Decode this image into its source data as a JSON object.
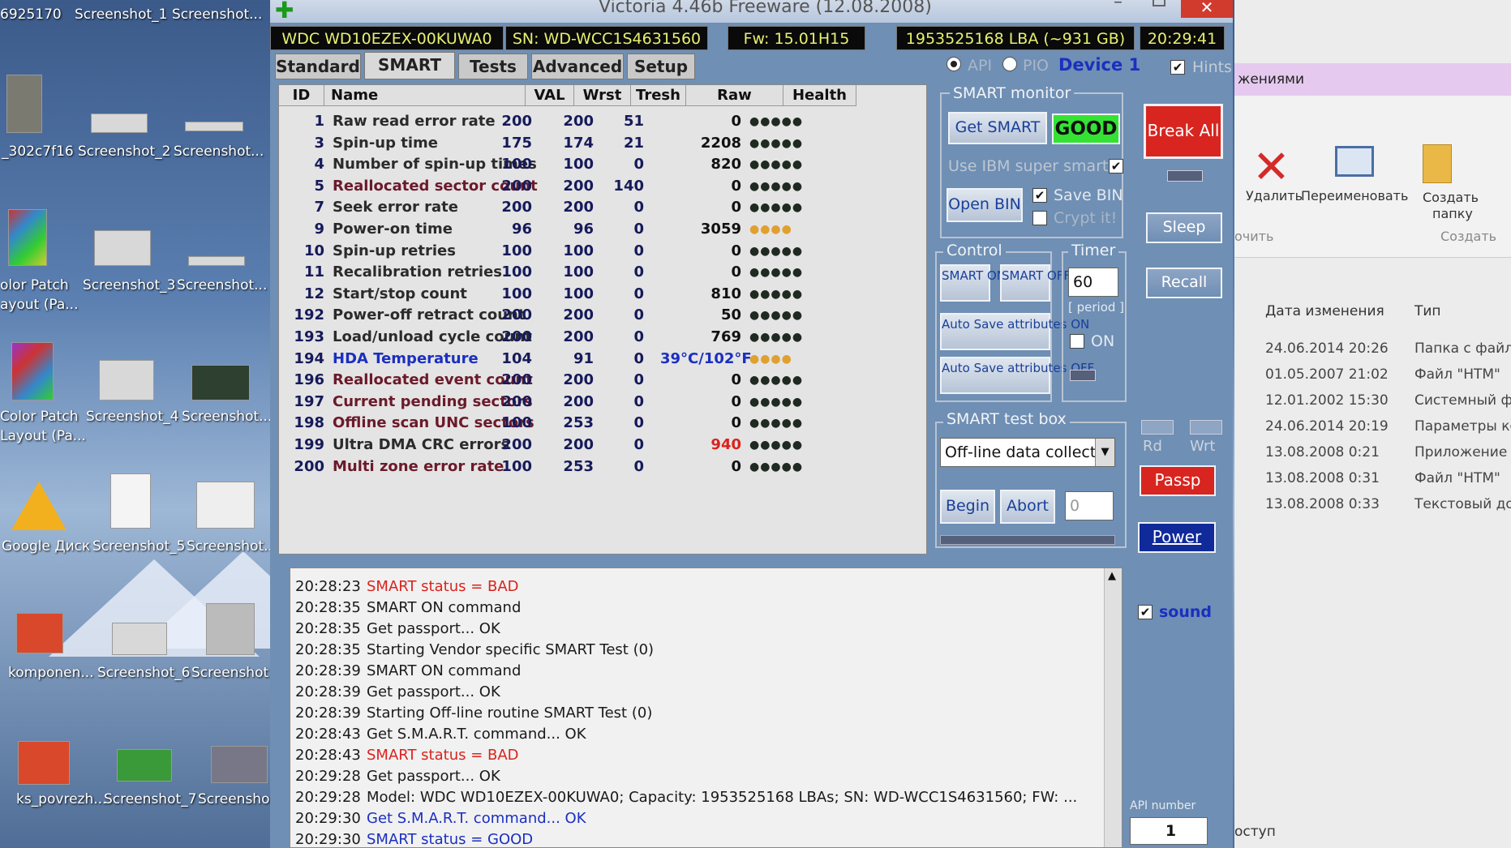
{
  "desktop": {
    "icons": [
      {
        "label": "6925170"
      },
      {
        "label": "Screenshot_1"
      },
      {
        "label": "Screenshot..."
      },
      {
        "label": "_302c7f16"
      },
      {
        "label": "Screenshot_2"
      },
      {
        "label": "Screenshot..."
      },
      {
        "label": "olor Patch"
      },
      {
        "label": "ayout (Pa..."
      },
      {
        "label": "Screenshot_3"
      },
      {
        "label": "Screenshot..."
      },
      {
        "label": "Color Patch"
      },
      {
        "label": "Layout (Pa..."
      },
      {
        "label": "Screenshot_4"
      },
      {
        "label": "Screenshot..."
      },
      {
        "label": "Google Диск"
      },
      {
        "label": "Screenshot_5"
      },
      {
        "label": "Screenshot..."
      },
      {
        "label": "komponen..."
      },
      {
        "label": "Screenshot_6"
      },
      {
        "label": "Screenshot..."
      },
      {
        "label": "ks_povrezh..."
      },
      {
        "label": "Screenshot_7"
      },
      {
        "label": "Screenshot..."
      }
    ]
  },
  "window": {
    "title": "Victoria 4.46b Freeware (12.08.2008)",
    "close_label": "✕",
    "min_label": "–"
  },
  "info": {
    "model": "WDC WD10EZEX-00KUWA0",
    "serial": "SN: WD-WCC1S4631560",
    "firmware": "Fw: 15.01H15",
    "lba": "1953525168 LBA (~931 GB)",
    "clock": "20:29:41"
  },
  "tabs": [
    "Standard",
    "SMART",
    "Tests",
    "Advanced",
    "Setup"
  ],
  "mode": {
    "api": "API",
    "pio": "PIO",
    "device": "Device 1",
    "hints": "Hints"
  },
  "table": {
    "headers": [
      "ID",
      "Name",
      "VAL",
      "Wrst",
      "Tresh",
      "Raw",
      "Health"
    ],
    "rows": [
      {
        "id": "1",
        "name": "Raw read error rate",
        "val": "200",
        "wrst": "200",
        "tresh": "51",
        "raw": "0",
        "health": "●●●●●",
        "name_color": "#2b2b2b",
        "raw_color": "#111",
        "health_color": "#1f2a20"
      },
      {
        "id": "3",
        "name": "Spin-up time",
        "val": "175",
        "wrst": "174",
        "tresh": "21",
        "raw": "2208",
        "health": "●●●●●",
        "name_color": "#2b2b2b",
        "raw_color": "#111",
        "health_color": "#1f2a20"
      },
      {
        "id": "4",
        "name": "Number of spin-up times",
        "val": "100",
        "wrst": "100",
        "tresh": "0",
        "raw": "820",
        "health": "●●●●●",
        "name_color": "#2b2b2b",
        "raw_color": "#111",
        "health_color": "#1f2a20"
      },
      {
        "id": "5",
        "name": "Reallocated sector count",
        "val": "200",
        "wrst": "200",
        "tresh": "140",
        "raw": "0",
        "health": "●●●●●",
        "name_color": "#6b1a2a",
        "raw_color": "#111",
        "health_color": "#1f2a20"
      },
      {
        "id": "7",
        "name": "Seek error rate",
        "val": "200",
        "wrst": "200",
        "tresh": "0",
        "raw": "0",
        "health": "●●●●●",
        "name_color": "#2b2b2b",
        "raw_color": "#111",
        "health_color": "#1f2a20"
      },
      {
        "id": "9",
        "name": "Power-on time",
        "val": "96",
        "wrst": "96",
        "tresh": "0",
        "raw": "3059",
        "health": "●●●●",
        "name_color": "#2b2b2b",
        "raw_color": "#111",
        "health_color": "#e0a030"
      },
      {
        "id": "10",
        "name": "Spin-up retries",
        "val": "100",
        "wrst": "100",
        "tresh": "0",
        "raw": "0",
        "health": "●●●●●",
        "name_color": "#2b2b2b",
        "raw_color": "#111",
        "health_color": "#1f2a20"
      },
      {
        "id": "11",
        "name": "Recalibration retries",
        "val": "100",
        "wrst": "100",
        "tresh": "0",
        "raw": "0",
        "health": "●●●●●",
        "name_color": "#2b2b2b",
        "raw_color": "#111",
        "health_color": "#1f2a20"
      },
      {
        "id": "12",
        "name": "Start/stop count",
        "val": "100",
        "wrst": "100",
        "tresh": "0",
        "raw": "810",
        "health": "●●●●●",
        "name_color": "#2b2b2b",
        "raw_color": "#111",
        "health_color": "#1f2a20"
      },
      {
        "id": "192",
        "name": "Power-off retract count",
        "val": "200",
        "wrst": "200",
        "tresh": "0",
        "raw": "50",
        "health": "●●●●●",
        "name_color": "#2b2b2b",
        "raw_color": "#111",
        "health_color": "#1f2a20"
      },
      {
        "id": "193",
        "name": "Load/unload cycle count",
        "val": "200",
        "wrst": "200",
        "tresh": "0",
        "raw": "769",
        "health": "●●●●●",
        "name_color": "#2b2b2b",
        "raw_color": "#111",
        "health_color": "#1f2a20"
      },
      {
        "id": "194",
        "name": "HDA Temperature",
        "val": "104",
        "wrst": "91",
        "tresh": "0",
        "raw": "39°C/102°F",
        "health": "●●●●",
        "name_color": "#1b2fc0",
        "raw_color": "#1b2fc0",
        "health_color": "#e0a030"
      },
      {
        "id": "196",
        "name": "Reallocated event count",
        "val": "200",
        "wrst": "200",
        "tresh": "0",
        "raw": "0",
        "health": "●●●●●",
        "name_color": "#6b1a2a",
        "raw_color": "#111",
        "health_color": "#1f2a20"
      },
      {
        "id": "197",
        "name": "Current pending sectors",
        "val": "200",
        "wrst": "200",
        "tresh": "0",
        "raw": "0",
        "health": "●●●●●",
        "name_color": "#6b1a2a",
        "raw_color": "#111",
        "health_color": "#1f2a20"
      },
      {
        "id": "198",
        "name": "Offline scan UNC sectors",
        "val": "100",
        "wrst": "253",
        "tresh": "0",
        "raw": "0",
        "health": "●●●●●",
        "name_color": "#6b1a2a",
        "raw_color": "#111",
        "health_color": "#1f2a20"
      },
      {
        "id": "199",
        "name": "Ultra DMA CRC errors",
        "val": "200",
        "wrst": "200",
        "tresh": "0",
        "raw": "940",
        "health": "●●●●●",
        "name_color": "#2b2b2b",
        "raw_color": "#d9231e",
        "health_color": "#1f2a20"
      },
      {
        "id": "200",
        "name": "Multi zone error rate",
        "val": "100",
        "wrst": "253",
        "tresh": "0",
        "raw": "0",
        "health": "●●●●●",
        "name_color": "#6b1a2a",
        "raw_color": "#111",
        "health_color": "#1f2a20"
      }
    ]
  },
  "smart_monitor": {
    "title": "SMART monitor",
    "get_smart": "Get SMART",
    "status": "GOOD",
    "ibm_label": "Use IBM super smart:",
    "open_bin": "Open BIN",
    "save_bin": "Save BIN",
    "crypt": "Crypt it!"
  },
  "control": {
    "title": "Control",
    "smart_on": "SMART ON",
    "smart_off": "SMART OFF",
    "auto_on": "Auto Save attributes ON",
    "auto_off": "Auto Save attributes OFF"
  },
  "timer": {
    "title": "Timer",
    "value": "60",
    "period": "[ period ]",
    "on": "ON"
  },
  "test_box": {
    "title": "SMART test box",
    "selected": "Off-line data collect",
    "begin": "Begin",
    "abort": "Abort",
    "value": "0"
  },
  "side": {
    "break_all": "Break All",
    "sleep": "Sleep",
    "recall": "Recall",
    "rd": "Rd",
    "wrt": "Wrt",
    "passp": "Passp",
    "power": "Power",
    "sound": "sound",
    "api_number_label": "API number",
    "api_number": "1"
  },
  "log": [
    {
      "time": "20:28:23",
      "text": "SMART status = BAD",
      "color": "#d9231e"
    },
    {
      "time": "20:28:35",
      "text": "SMART ON command",
      "color": "#1a1a1a"
    },
    {
      "time": "20:28:35",
      "text": "Get passport... OK",
      "color": "#1a1a1a"
    },
    {
      "time": "20:28:35",
      "text": "Starting Vendor specific SMART Test (0)",
      "color": "#1a1a1a"
    },
    {
      "time": "20:28:39",
      "text": "SMART ON command",
      "color": "#1a1a1a"
    },
    {
      "time": "20:28:39",
      "text": "Get passport... OK",
      "color": "#1a1a1a"
    },
    {
      "time": "20:28:39",
      "text": "Starting Off-line routine SMART Test (0)",
      "color": "#1a1a1a"
    },
    {
      "time": "20:28:43",
      "text": "Get S.M.A.R.T. command... OK",
      "color": "#1a1a1a"
    },
    {
      "time": "20:28:43",
      "text": "SMART status = BAD",
      "color": "#d9231e"
    },
    {
      "time": "20:29:28",
      "text": "Get passport... OK",
      "color": "#1a1a1a"
    },
    {
      "time": "20:29:28",
      "text": "Model: WDC WD10EZEX-00KUWA0; Capacity: 1953525168 LBAs; SN: WD-WCC1S4631560; FW: ...",
      "color": "#1a1a1a"
    },
    {
      "time": "20:29:30",
      "text": "Get S.M.A.R.T. command... OK",
      "color": "#1b2fc0"
    },
    {
      "time": "20:29:30",
      "text": "SMART status = GOOD",
      "color": "#1b2fc0"
    }
  ],
  "explorer": {
    "header": "жениями",
    "delete": "Удалить",
    "rename": "Переименовать",
    "new_folder_1": "Создать",
    "new_folder_2": "папку",
    "group_left": "очить",
    "group_create": "Создать",
    "col_date": "Дата изменения",
    "col_type": "Тип",
    "rows": [
      {
        "date": "24.06.2014 20:26",
        "type": "Папка с файла"
      },
      {
        "date": "01.05.2007 21:02",
        "type": "Файл \"HTM\""
      },
      {
        "date": "12.01.2002 15:30",
        "type": "Системный фа"
      },
      {
        "date": "24.06.2014 20:19",
        "type": "Параметры кон"
      },
      {
        "date": "13.08.2008 0:21",
        "type": "Приложение"
      },
      {
        "date": "13.08.2008 0:31",
        "type": "Файл \"HTM\""
      },
      {
        "date": "13.08.2008 0:33",
        "type": "Текстовый доку"
      }
    ],
    "access": "оступ"
  }
}
